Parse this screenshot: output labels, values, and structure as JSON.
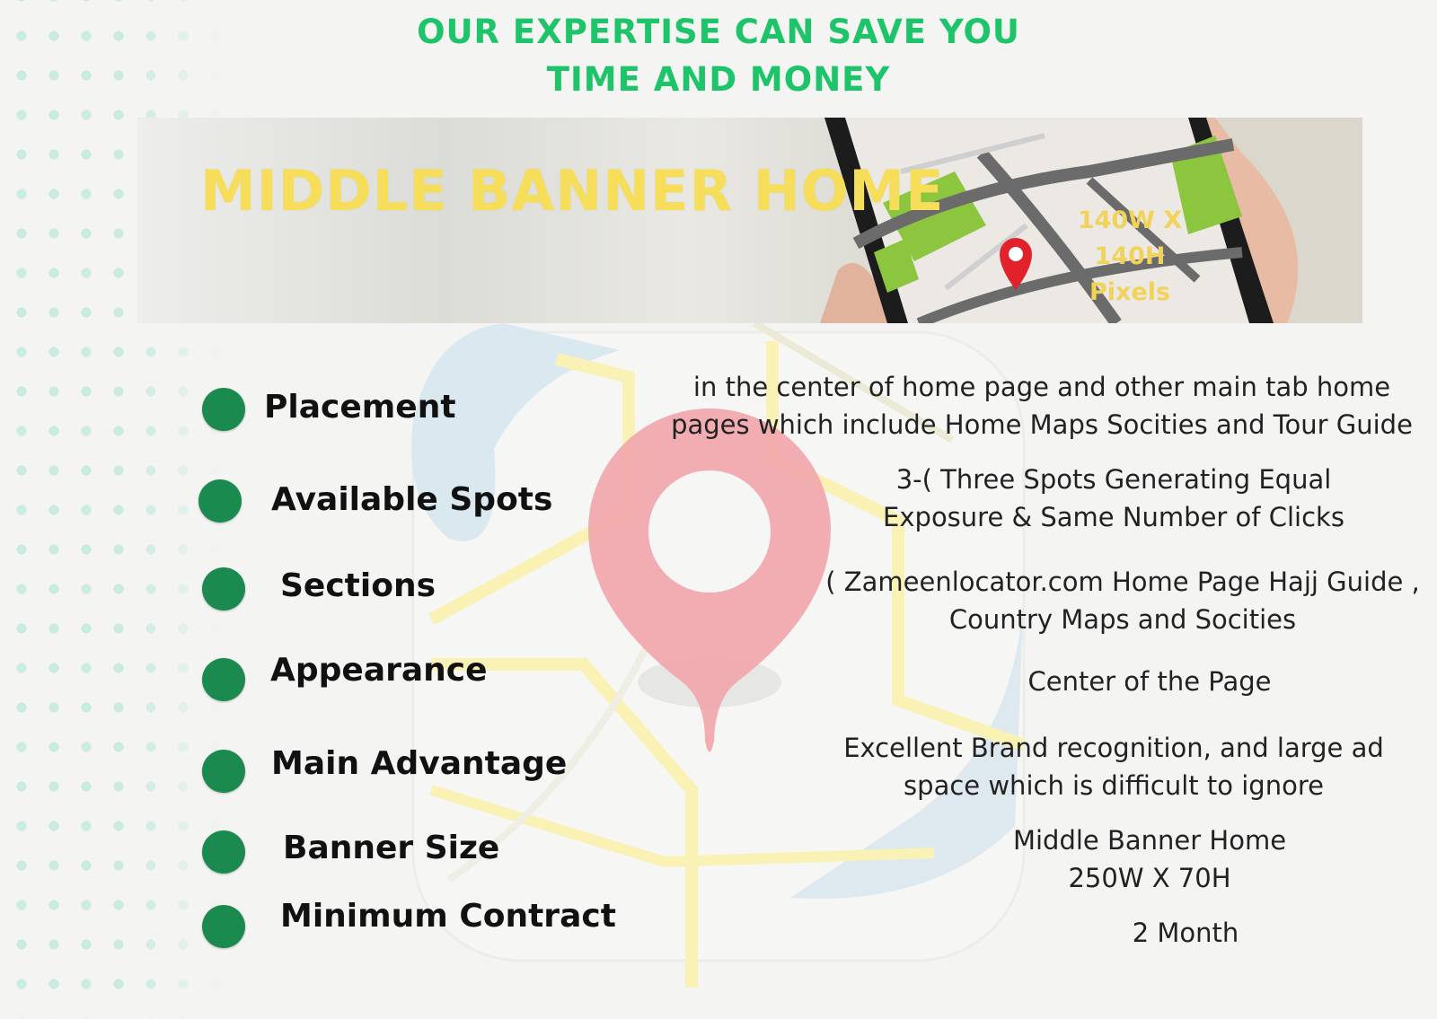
{
  "header": {
    "line1": "OUR EXPERTISE CAN SAVE YOU",
    "line2": "TIME AND MONEY"
  },
  "banner": {
    "title": "MIDDLE BANNER HOME",
    "size_line1": "140W X 140H",
    "size_line2": "Pixels"
  },
  "rows": [
    {
      "label": "Placement",
      "value_line1": "in the center of home page and other main tab home",
      "value_line2": "pages which include Home Maps Socities and Tour Guide"
    },
    {
      "label": "Available Spots",
      "value_line1": "3-( Three Spots Generating Equal",
      "value_line2": "Exposure & Same Number of Clicks"
    },
    {
      "label": "Sections",
      "value_line1": "( Zameenlocator.com Home Page Hajj Guide ,",
      "value_line2": "Country Maps and Socities"
    },
    {
      "label": "Appearance",
      "value_line1": "Center of the Page"
    },
    {
      "label": "Main Advantage",
      "value_line1": "Excellent Brand recognition, and large ad",
      "value_line2": "space which is difficult to ignore"
    },
    {
      "label": "Banner Size",
      "value_line1": "Middle Banner Home",
      "value_line2": "250W X 70H"
    },
    {
      "label": "Minimum Contract",
      "value_line1": "2 Month"
    }
  ],
  "colors": {
    "headline": "#1ec46a",
    "banner_title": "#f6dd5a",
    "bullet": "#1a8a4e",
    "pin": "#f2a0a6",
    "dots": "#c9ece0"
  },
  "icons": [
    "map-pin-icon",
    "smartphone-map-image",
    "bullet-dot-icon"
  ]
}
